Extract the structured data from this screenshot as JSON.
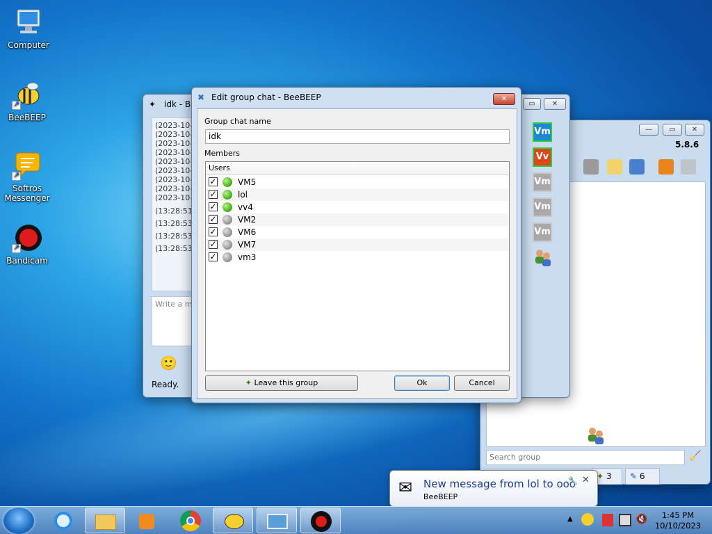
{
  "desktop": {
    "icons": [
      {
        "label": "Computer",
        "icon": "computer-icon"
      },
      {
        "label": "BeeBEEP",
        "icon": "bee-icon"
      },
      {
        "label": "Softros Messenger",
        "icon": "speech-bubble-icon"
      },
      {
        "label": "Bandicam",
        "icon": "record-icon"
      }
    ]
  },
  "chat_window": {
    "title": "idk - Be",
    "log": [
      "(2023-10-1",
      "(2023-10-1",
      "(2023-10-1",
      "(2023-10-1",
      "(2023-10-1",
      "(2023-10-1",
      "(2023-10-1",
      "(2023-10-1",
      "(2023-10-1",
      "(13:28:51)",
      "(13:28:53)",
      "(13:28:53)",
      "(13:28:53)"
    ],
    "input_placeholder": "Write a me",
    "status": "Ready.",
    "side_badges": [
      {
        "text": "Vm",
        "color": "#1f86d6",
        "border": "#2ecc40"
      },
      {
        "text": "Vv",
        "color": "#e0441b",
        "border": "#2ecc40"
      },
      {
        "text": "Vm",
        "color": "#a8a8a8",
        "border": "#c8c8c8"
      },
      {
        "text": "Vm",
        "color": "#a8a8a8",
        "border": "#c8c8c8"
      },
      {
        "text": "Vm",
        "color": "#a8a8a8",
        "border": "#c8c8c8"
      }
    ]
  },
  "main_window": {
    "version": "5.8.6",
    "search_placeholder": "Search group",
    "tab_groups_count": "3",
    "tab_chats_count": "6"
  },
  "dialog": {
    "title": "Edit group chat - BeeBEEP",
    "group_name_label": "Group chat name",
    "group_name_value": "idk",
    "members_label": "Members",
    "users_header": "Users",
    "members": [
      {
        "name": "VM5",
        "online": true,
        "checked": true
      },
      {
        "name": "lol",
        "online": true,
        "checked": true
      },
      {
        "name": "vv4",
        "online": true,
        "checked": true
      },
      {
        "name": "VM2",
        "online": false,
        "checked": true
      },
      {
        "name": "VM6",
        "online": false,
        "checked": true
      },
      {
        "name": "VM7",
        "online": false,
        "checked": true
      },
      {
        "name": "vm3",
        "online": false,
        "checked": true
      }
    ],
    "leave_button": "Leave this group",
    "ok_button": "Ok",
    "cancel_button": "Cancel"
  },
  "notification": {
    "title": "New message from lol to ooo",
    "app": "BeeBEEP"
  },
  "taskbar": {
    "time": "1:45 PM",
    "date": "10/10/2023"
  }
}
